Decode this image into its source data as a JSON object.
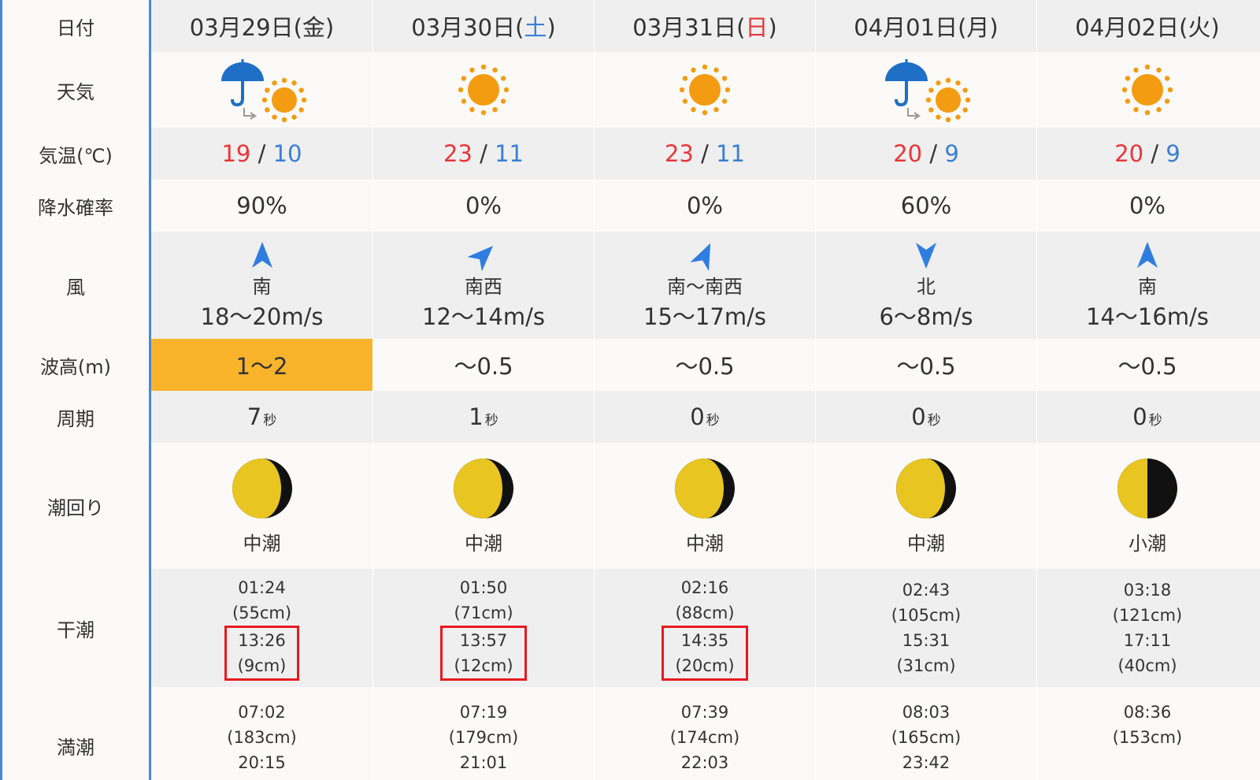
{
  "labels": {
    "date": "日付",
    "weather": "天気",
    "temp": "気温(℃)",
    "rain": "降水確率",
    "wind": "風",
    "wave": "波高(m)",
    "period": "周期",
    "tide": "潮回り",
    "low": "干潮",
    "high": "満潮"
  },
  "days": [
    {
      "date_main": "03月29日(",
      "weekday": "金",
      "date_close": ")",
      "weekday_type": "weekday",
      "weather": "rain-then-sun",
      "temp_high": "19",
      "temp_low": "10",
      "rain": "90%",
      "wind_dir": "南",
      "wind_speed": "18～20m/s",
      "wind_icon": "arrow-up-icon",
      "wave": "1～2",
      "wave_alert": true,
      "period_value": "7",
      "period_unit": "秒",
      "moon_icon": "waxing-gibbous-moon-icon",
      "tide_name": "中潮",
      "low_tides": [
        {
          "time": "01:24",
          "level": "(55cm)"
        },
        {
          "time": "13:26",
          "level": "(9cm)",
          "highlight": true
        }
      ],
      "high_tides": [
        {
          "time": "07:02",
          "level": "(183cm)"
        },
        {
          "time": "20:15"
        }
      ]
    },
    {
      "date_main": "03月30日(",
      "weekday": "土",
      "date_close": ")",
      "weekday_type": "saturday",
      "weather": "sunny",
      "temp_high": "23",
      "temp_low": "11",
      "rain": "0%",
      "wind_dir": "南西",
      "wind_speed": "12～14m/s",
      "wind_icon": "arrow-northeast-icon",
      "wave": "～0.5",
      "wave_alert": false,
      "period_value": "1",
      "period_unit": "秒",
      "moon_icon": "waxing-gibbous-moon-icon",
      "tide_name": "中潮",
      "low_tides": [
        {
          "time": "01:50",
          "level": "(71cm)"
        },
        {
          "time": "13:57",
          "level": "(12cm)",
          "highlight": true
        }
      ],
      "high_tides": [
        {
          "time": "07:19",
          "level": "(179cm)"
        },
        {
          "time": "21:01"
        }
      ]
    },
    {
      "date_main": "03月31日(",
      "weekday": "日",
      "date_close": ")",
      "weekday_type": "sunday",
      "weather": "sunny",
      "temp_high": "23",
      "temp_low": "11",
      "rain": "0%",
      "wind_dir": "南～南西",
      "wind_speed": "15～17m/s",
      "wind_icon": "arrow-up-northeast-icon",
      "wave": "～0.5",
      "wave_alert": false,
      "period_value": "0",
      "period_unit": "秒",
      "moon_icon": "waxing-gibbous-moon-icon",
      "tide_name": "中潮",
      "low_tides": [
        {
          "time": "02:16",
          "level": "(88cm)"
        },
        {
          "time": "14:35",
          "level": "(20cm)",
          "highlight": true
        }
      ],
      "high_tides": [
        {
          "time": "07:39",
          "level": "(174cm)"
        },
        {
          "time": "22:03"
        }
      ]
    },
    {
      "date_main": "04月01日(",
      "weekday": "月",
      "date_close": ")",
      "weekday_type": "weekday",
      "weather": "rain-then-sun",
      "temp_high": "20",
      "temp_low": "9",
      "rain": "60%",
      "wind_dir": "北",
      "wind_speed": "6～8m/s",
      "wind_icon": "arrow-down-icon",
      "wave": "～0.5",
      "wave_alert": false,
      "period_value": "0",
      "period_unit": "秒",
      "moon_icon": "waxing-gibbous-moon-icon",
      "tide_name": "中潮",
      "low_tides": [
        {
          "time": "02:43",
          "level": "(105cm)"
        },
        {
          "time": "15:31",
          "level": "(31cm)"
        }
      ],
      "high_tides": [
        {
          "time": "08:03",
          "level": "(165cm)"
        },
        {
          "time": "23:42"
        }
      ]
    },
    {
      "date_main": "04月02日(",
      "weekday": "火",
      "date_close": ")",
      "weekday_type": "weekday",
      "weather": "sunny",
      "temp_high": "20",
      "temp_low": "9",
      "rain": "0%",
      "wind_dir": "南",
      "wind_speed": "14～16m/s",
      "wind_icon": "arrow-up-icon",
      "wave": "～0.5",
      "wave_alert": false,
      "period_value": "0",
      "period_unit": "秒",
      "moon_icon": "half-moon-icon",
      "tide_name": "小潮",
      "low_tides": [
        {
          "time": "03:18",
          "level": "(121cm)"
        },
        {
          "time": "17:11",
          "level": "(40cm)"
        }
      ],
      "high_tides": [
        {
          "time": "08:36",
          "level": "(153cm)"
        }
      ]
    }
  ],
  "colors": {
    "accent_blue": "#4a86d8",
    "high_temp": "#e8363a",
    "low_temp": "#3a7fd4",
    "wave_alert": "#f9b42c",
    "highlight_box": "#e8191f",
    "sun": "#f39c12",
    "moon": "#e8c520"
  }
}
